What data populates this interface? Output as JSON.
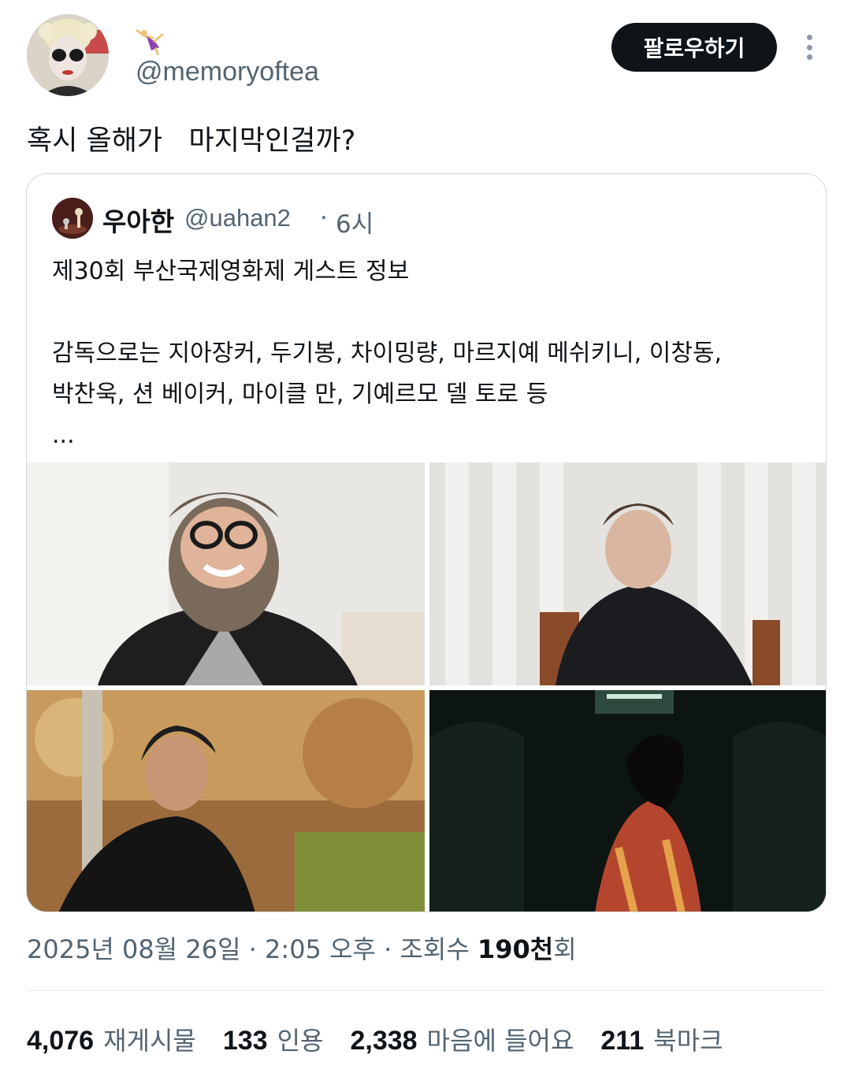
{
  "tweet": {
    "handle": "@memoryoftea",
    "follow_label": "팔로우하기",
    "text": "혹시 올해가   마지막인걸까?",
    "icons": {
      "avatar": "user-avatar",
      "name_emoji": "dancer-emoji",
      "more": "more-vertical-icon"
    }
  },
  "quote": {
    "name": "우아한",
    "handle": "@uahan2",
    "separator": "·",
    "time": "6시",
    "body_lines": [
      "제30회 부산국제영화제 게스트 정보",
      "",
      "감독으로는 지아장커, 두기봉, 차이밍량, 마르지예 메쉬키니, 이창동,",
      "박찬욱, 션 베이커, 마이클 만, 기예르모 델 토로 등",
      "..."
    ]
  },
  "meta": {
    "date": "2025년 08월 26일 · 2:05 오후 · 조회수 ",
    "views_number": "190천",
    "views_suffix": "회"
  },
  "stats": [
    {
      "value": "4,076",
      "label": "재게시물"
    },
    {
      "value": "133",
      "label": "인용"
    },
    {
      "value": "2,338",
      "label": "마음에 들어요"
    },
    {
      "value": "211",
      "label": "북마크"
    }
  ],
  "colors": {
    "text": "#0f1419",
    "secondary": "#536471",
    "border": "#cfd9de",
    "button": "#0f1419"
  }
}
